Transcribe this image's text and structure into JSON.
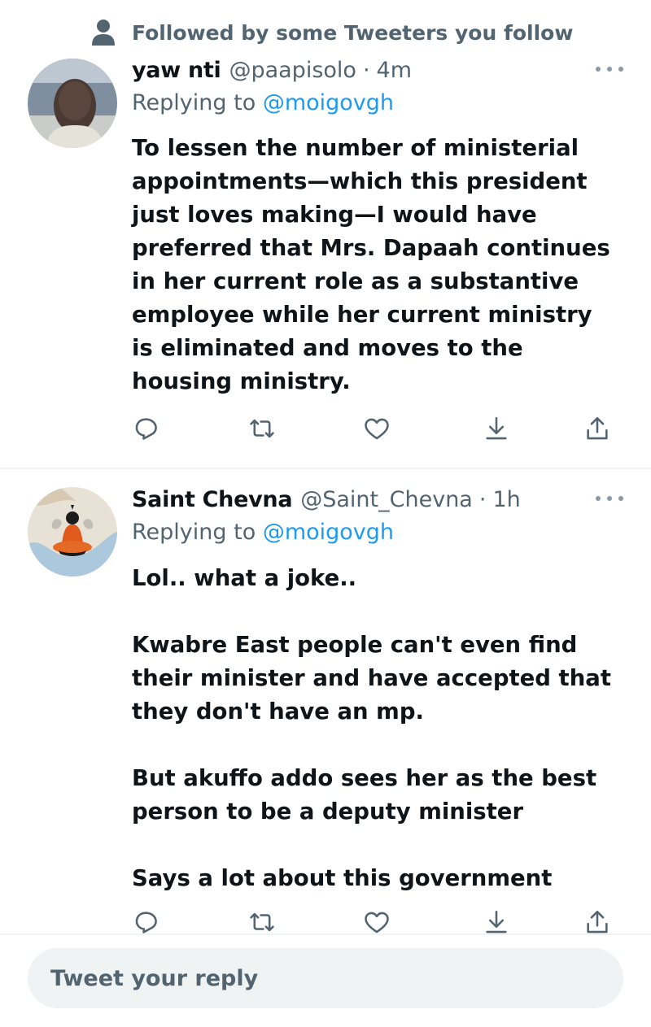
{
  "social_context": {
    "text": "Followed by some Tweeters you follow",
    "icon": "person-icon"
  },
  "tweets": [
    {
      "name": "yaw nti",
      "handle": "@paapisolo",
      "separator": "·",
      "time": "4m",
      "replying_prefix": "Replying to ",
      "replying_to": "@moigovgh",
      "paragraphs": [
        "To lessen the number of ministerial appointments—which this president just loves making—I would have preferred that Mrs. Dapaah continues in her current role as a substantive employee while her current ministry is eliminated and moves to the housing ministry."
      ]
    },
    {
      "name": "Saint Chevna",
      "handle": "@Saint_Chevna",
      "separator": "·",
      "time": "1h",
      "replying_prefix": "Replying to ",
      "replying_to": "@moigovgh",
      "paragraphs": [
        "Lol.. what a joke..",
        "Kwabre East people can't even find their minister and have accepted that they don't have an mp.",
        "But akuffo addo sees her as the best person to be a deputy minister",
        "Says a lot about this government"
      ]
    }
  ],
  "action_icons": [
    "reply-icon",
    "retweet-icon",
    "like-icon",
    "download-icon",
    "share-icon"
  ],
  "reply_bar": {
    "placeholder": "Tweet your reply"
  },
  "colors": {
    "accent": "#1d9bf0",
    "secondary_text": "#536471",
    "primary_text": "#0f1419",
    "divider": "#eff3f4"
  }
}
